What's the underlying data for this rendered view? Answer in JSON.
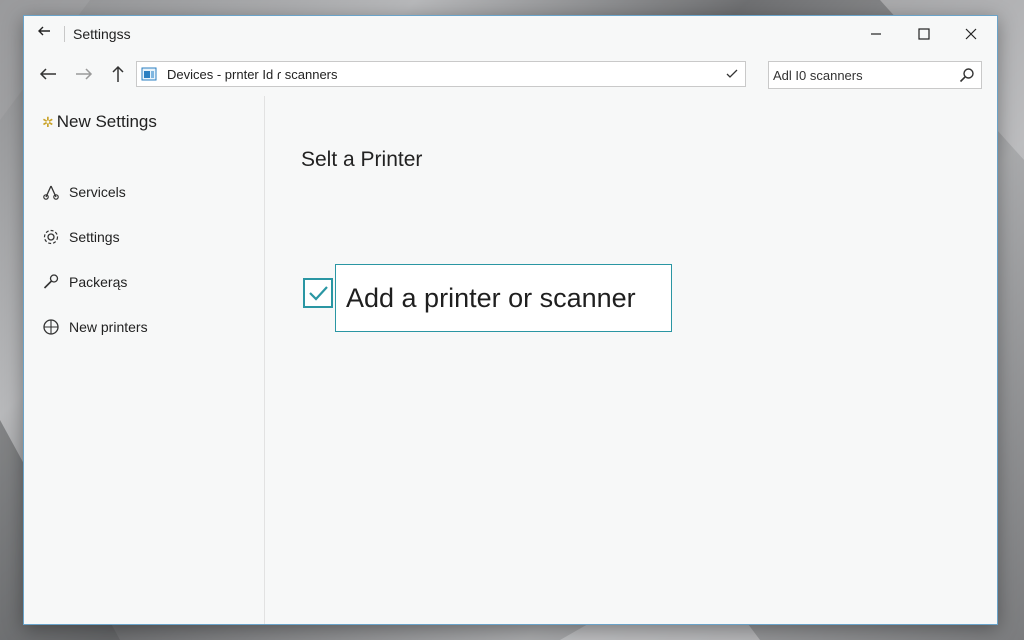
{
  "window": {
    "title": "Settingss",
    "back_icon": "back-arrow-icon",
    "controls": [
      "minimize-icon",
      "maximize-icon",
      "close-icon"
    ],
    "accent_color": "#2a96a3"
  },
  "navbar": {
    "address_text": "Devices - prnter Id ɾ scanners",
    "search_text": "Adl I0 scanners"
  },
  "sidebar": {
    "header": {
      "icon": "sparkle-icon",
      "label": "New Settings"
    },
    "items": [
      {
        "label": "Servicels",
        "icon": "services-icon"
      },
      {
        "label": "Settings",
        "icon": "settings-icon"
      },
      {
        "label": "Packerąs",
        "icon": "wrench-icon"
      },
      {
        "label": "New printers",
        "icon": "globe-icon"
      }
    ]
  },
  "main": {
    "title": "Selt a Printer",
    "add_button_label": "Add a printer or scanner",
    "checkbox_checked": true
  }
}
